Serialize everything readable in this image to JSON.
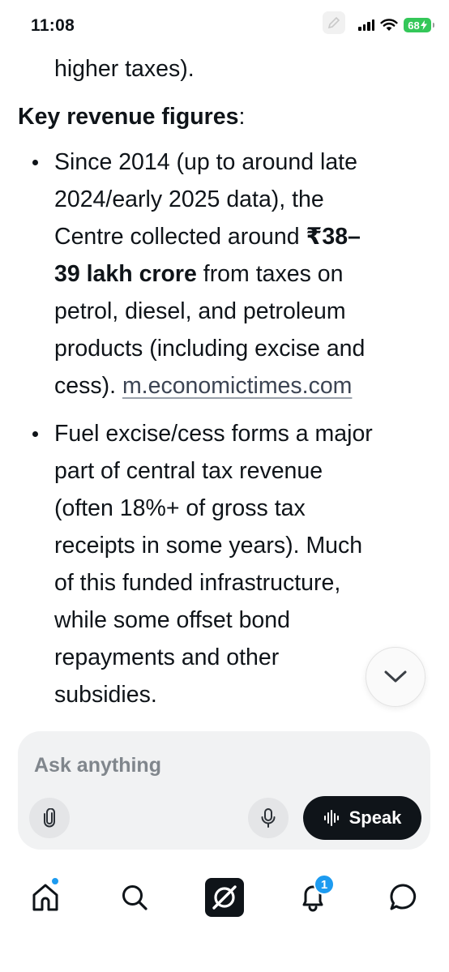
{
  "status_bar": {
    "time": "11:08",
    "battery_percent": "68",
    "battery_color": "#34c759",
    "icons": [
      "edit-icon",
      "cellular-signal-icon",
      "wifi-icon",
      "battery-icon"
    ]
  },
  "article": {
    "continued_line": "higher taxes).",
    "heading_bold": "Key revenue figures",
    "heading_colon": ":",
    "bullets": [
      {
        "line1": "Since 2014 (up to around late",
        "line2": "2024/early 2025 data), the",
        "line3_normal": "Centre collected around ",
        "line3_bold": "₹38–",
        "line4_bold": "39 lakh crore",
        "line4_normal": " from taxes on",
        "line5": "petrol, diesel, and petroleum",
        "line6": "products (including excise and",
        "line7_normal": "cess). ",
        "line7_link": "m.economictimes.com"
      },
      {
        "lines": [
          "Fuel excise/cess forms a major",
          "part of central tax revenue",
          "(often 18%+ of gross tax",
          "receipts in some years). Much",
          "of this funded infrastructure,",
          "while some offset bond",
          "repayments and other",
          "subsidies."
        ]
      }
    ]
  },
  "scroll_button": {
    "icon": "chevron-down-icon"
  },
  "composer": {
    "placeholder": "Ask anything",
    "attach_icon": "paperclip-icon",
    "mic_icon": "microphone-icon",
    "speak_label": "Speak",
    "speak_icon": "waveform-icon"
  },
  "bottom_nav": {
    "items": [
      "home-icon",
      "search-icon",
      "grok-icon",
      "bell-icon",
      "chat-icon"
    ],
    "notification_count": "1",
    "accent": "#1d9bf0"
  }
}
